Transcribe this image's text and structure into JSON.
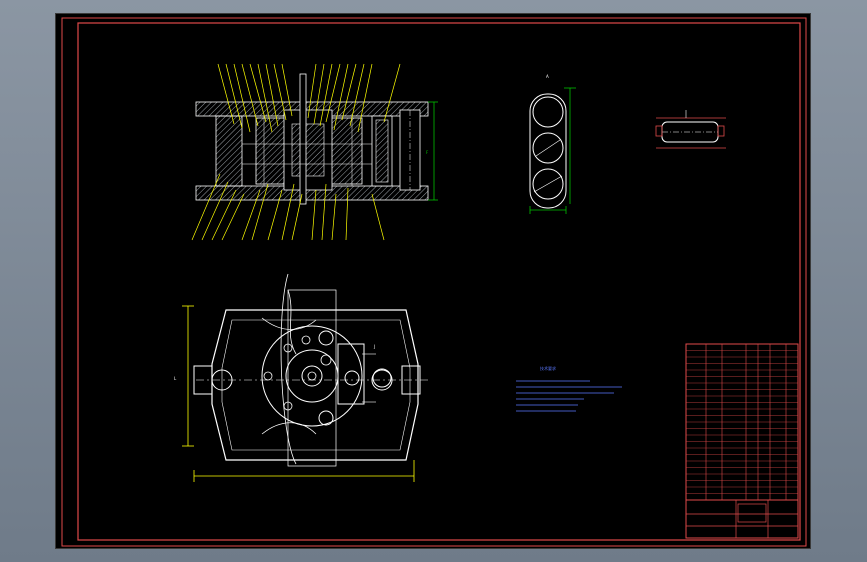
{
  "colors": {
    "background": "#000000",
    "frame": "#e04a4a",
    "outline": "#ffffff",
    "leader": "#ffff00",
    "dimension": "#00c000",
    "notes": "#5a78ff",
    "hatch": "#9aa0a6"
  },
  "section_view": {
    "dimension_label": "F"
  },
  "detail_view": {
    "label": "A"
  },
  "plan_view": {
    "left_label": "L",
    "right_label": "J"
  },
  "notes": {
    "title": "技术要求",
    "lines": [
      "",
      "",
      "",
      "",
      ""
    ]
  },
  "title_block": {
    "rows": 24
  }
}
